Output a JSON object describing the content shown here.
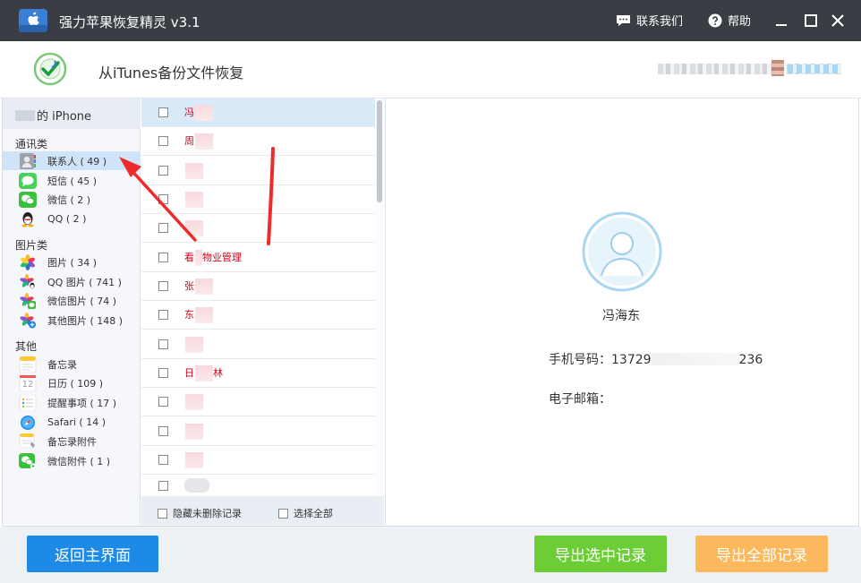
{
  "window": {
    "title": "强力苹果恢复精灵 v3.1",
    "contact_label": "联系我们",
    "help_label": "帮助"
  },
  "header": {
    "title": "从iTunes备份文件恢复"
  },
  "sidebar": {
    "device_name": "的 iPhone",
    "categories": [
      {
        "title": "通讯类",
        "items": [
          {
            "label": "联系人 ( 49 )",
            "icon": "contacts-icon"
          },
          {
            "label": "短信 ( 45 )",
            "icon": "messages-icon"
          },
          {
            "label": "微信 ( 2 )",
            "icon": "wechat-icon"
          },
          {
            "label": "QQ ( 2 )",
            "icon": "qq-icon"
          }
        ]
      },
      {
        "title": "图片类",
        "items": [
          {
            "label": "图片 ( 34 )",
            "icon": "photos-icon"
          },
          {
            "label": "QQ 图片 ( 741 )",
            "icon": "qq-photos-icon"
          },
          {
            "label": "微信图片 ( 74 )",
            "icon": "wechat-photos-icon"
          },
          {
            "label": "其他图片 ( 148 )",
            "icon": "other-photos-icon"
          }
        ]
      },
      {
        "title": "其他",
        "items": [
          {
            "label": "备忘录",
            "icon": "notes-icon"
          },
          {
            "label": "日历 ( 109 )",
            "icon": "calendar-icon"
          },
          {
            "label": "提醒事项 ( 17 )",
            "icon": "reminders-icon"
          },
          {
            "label": "Safari ( 14 )",
            "icon": "safari-icon"
          },
          {
            "label": "备忘录附件",
            "icon": "notes-attachment-icon"
          },
          {
            "label": "微信附件 ( 1 )",
            "icon": "wechat-attachment-icon"
          }
        ]
      }
    ]
  },
  "contacts": {
    "rows": [
      {
        "prefix": "冯",
        "suffix": ""
      },
      {
        "prefix": "周",
        "suffix": ""
      },
      {
        "prefix": "",
        "suffix": ""
      },
      {
        "prefix": "",
        "suffix": ""
      },
      {
        "prefix": "",
        "suffix": ""
      },
      {
        "prefix": "看",
        "suffix": "物业管理"
      },
      {
        "prefix": "张",
        "suffix": ""
      },
      {
        "prefix": "东",
        "suffix": ""
      },
      {
        "prefix": "",
        "suffix": ""
      },
      {
        "prefix": "日",
        "suffix": "林"
      },
      {
        "prefix": "",
        "suffix": ""
      },
      {
        "prefix": "",
        "suffix": ""
      },
      {
        "prefix": "",
        "suffix": ""
      },
      {
        "prefix": "",
        "suffix": ""
      }
    ],
    "hide_undeleted_label": "隐藏未删除记录",
    "select_all_label": "选择全部"
  },
  "detail": {
    "name": "冯海东",
    "phone_label": "手机号码：",
    "phone_visible_start": "13729",
    "phone_visible_end": "236",
    "email_label": "电子邮箱："
  },
  "actions": {
    "back_label": "返回主界面",
    "export_selected_label": "导出选中记录",
    "export_all_label": "导出全部记录"
  },
  "colors": {
    "titlebar": "#3a3d44",
    "accent_blue": "#1e8ae8",
    "accent_green": "#6ccd36",
    "accent_orange": "#fcb85c",
    "contact_text": "#d0021b"
  }
}
